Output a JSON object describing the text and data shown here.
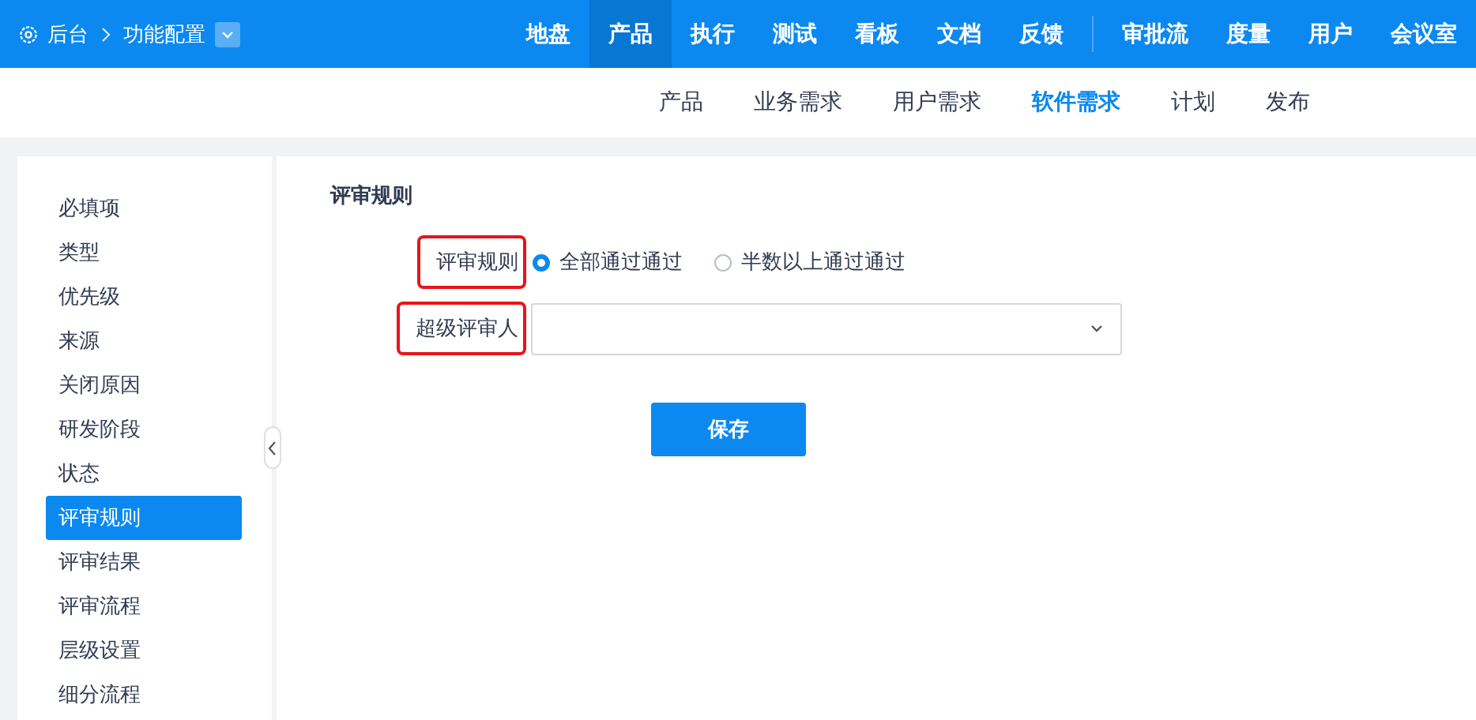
{
  "breadcrumb": {
    "home": "后台",
    "current": "功能配置"
  },
  "main_nav": {
    "items": [
      {
        "label": "地盘",
        "selected": false
      },
      {
        "label": "产品",
        "selected": true
      },
      {
        "label": "执行",
        "selected": false
      },
      {
        "label": "测试",
        "selected": false
      },
      {
        "label": "看板",
        "selected": false
      },
      {
        "label": "文档",
        "selected": false
      },
      {
        "label": "反馈",
        "selected": false
      }
    ],
    "extra_items": [
      {
        "label": "审批流",
        "selected": false
      },
      {
        "label": "度量",
        "selected": false
      },
      {
        "label": "用户",
        "selected": false
      },
      {
        "label": "会议室",
        "selected": false
      }
    ]
  },
  "sub_nav": [
    {
      "label": "产品",
      "selected": false
    },
    {
      "label": "业务需求",
      "selected": false
    },
    {
      "label": "用户需求",
      "selected": false
    },
    {
      "label": "软件需求",
      "selected": true
    },
    {
      "label": "计划",
      "selected": false
    },
    {
      "label": "发布",
      "selected": false
    }
  ],
  "sidebar": {
    "items": [
      {
        "label": "必填项",
        "selected": false
      },
      {
        "label": "类型",
        "selected": false
      },
      {
        "label": "优先级",
        "selected": false
      },
      {
        "label": "来源",
        "selected": false
      },
      {
        "label": "关闭原因",
        "selected": false
      },
      {
        "label": "研发阶段",
        "selected": false
      },
      {
        "label": "状态",
        "selected": false
      },
      {
        "label": "评审规则",
        "selected": true
      },
      {
        "label": "评审结果",
        "selected": false
      },
      {
        "label": "评审流程",
        "selected": false
      },
      {
        "label": "层级设置",
        "selected": false
      },
      {
        "label": "细分流程",
        "selected": false
      }
    ]
  },
  "form": {
    "title": "评审规则",
    "review_rule": {
      "label": "评审规则",
      "highlighted": true,
      "options": [
        {
          "label": "全部通过通过",
          "selected": true
        },
        {
          "label": "半数以上通过通过",
          "selected": false
        }
      ]
    },
    "super_reviewer": {
      "label": "超级评审人",
      "highlighted": true
    },
    "save_button": "保存"
  }
}
